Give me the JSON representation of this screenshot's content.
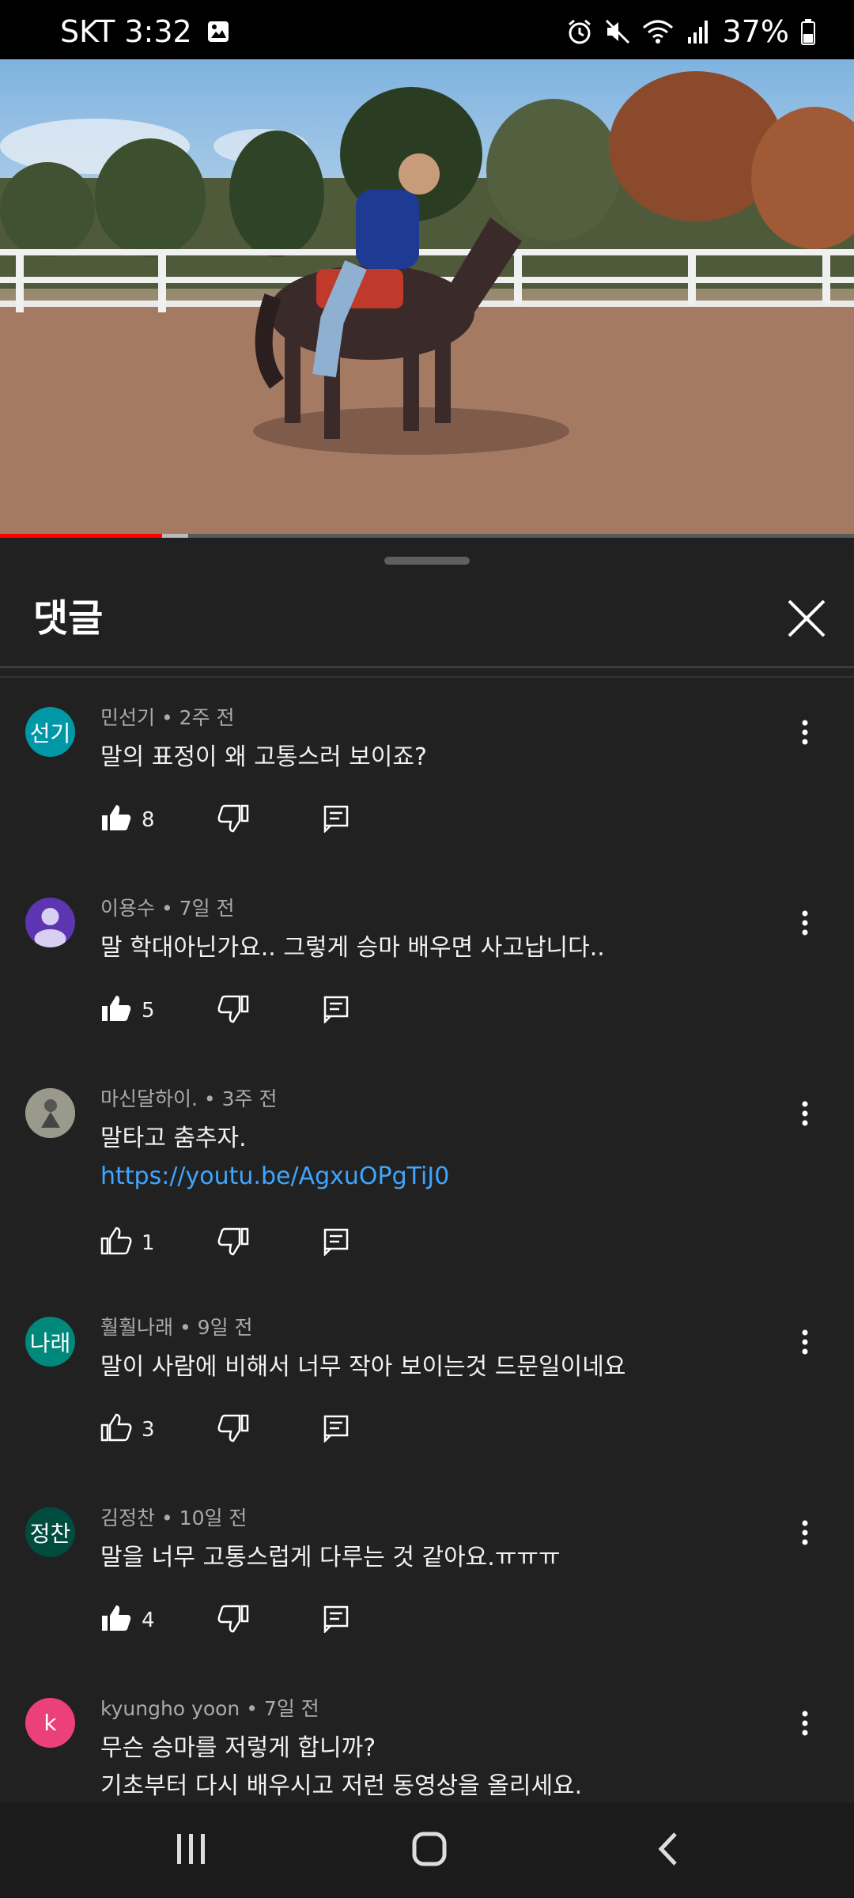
{
  "status_bar": {
    "carrier_time": "SKT 3:32",
    "battery": "37%",
    "icons": [
      "image-icon",
      "alarm-icon",
      "mute-icon",
      "wifi-icon",
      "signal-icon",
      "battery-icon"
    ]
  },
  "video": {
    "progress": 0.19,
    "buffered": 0.22
  },
  "panel": {
    "title": "댓글"
  },
  "comments": [
    {
      "avatar_text": "선기",
      "avatar_color": "#0097a7",
      "author": "민선기",
      "time": "2주 전",
      "text": "말의 표정이 왜 고통스러 보이죠?",
      "link": "",
      "likes": "8",
      "liked": true
    },
    {
      "avatar_text": "",
      "avatar_color": "#5e35b1",
      "author": "이용수",
      "time": "7일 전",
      "text": "말 학대아닌가요.. 그렇게 승마 배우면 사고납니다..",
      "link": "",
      "likes": "5",
      "liked": true
    },
    {
      "avatar_text": "",
      "avatar_color": "#8a8a7a",
      "author": "마신달하이.",
      "time": "3주 전",
      "text": "말타고 춤추자.",
      "link": "https://youtu.be/AgxuOPgTiJ0",
      "likes": "1",
      "liked": false
    },
    {
      "avatar_text": "나래",
      "avatar_color": "#00897b",
      "author": "훨훨나래",
      "time": "9일 전",
      "text": "말이 사람에 비해서 너무 작아 보이는것 드문일이네요",
      "link": "",
      "likes": "3",
      "liked": false
    },
    {
      "avatar_text": "정찬",
      "avatar_color": "#004d40",
      "author": "김정찬",
      "time": "10일 전",
      "text": "말을 너무 고통스럽게 다루는 것 같아요.ㅠㅠㅠ",
      "link": "",
      "likes": "4",
      "liked": true
    },
    {
      "avatar_text": "k",
      "avatar_color": "#ec407a",
      "author": "kyungho yoon",
      "time": "7일 전",
      "text": "무슨 승마를 저렇게 합니까?",
      "text2": "기초부터 다시 배우시고 저런 동영상을 올리세요.",
      "link": "",
      "likes": "",
      "liked": false
    }
  ]
}
